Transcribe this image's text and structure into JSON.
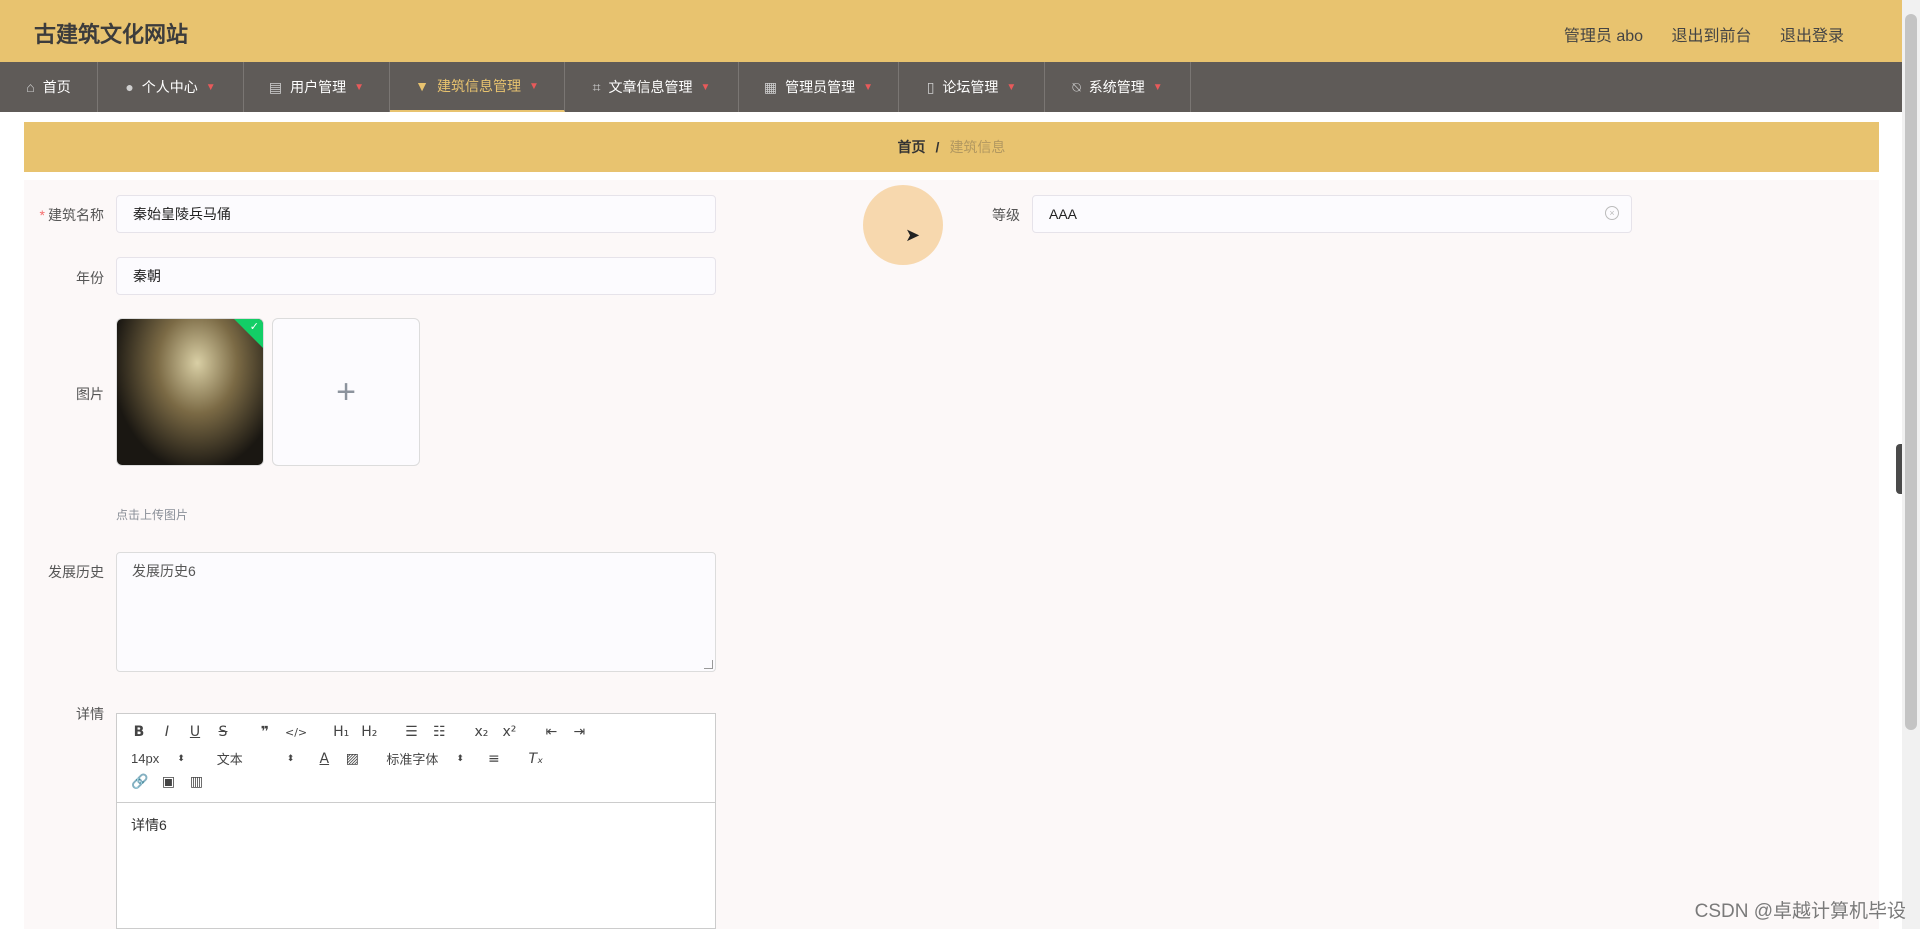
{
  "header": {
    "title": "古建筑文化网站",
    "admin_label": "管理员 abo",
    "goto_front": "退出到前台",
    "logout": "退出登录"
  },
  "nav": {
    "items": [
      {
        "label": "首页",
        "icon": "home-icon"
      },
      {
        "label": "个人中心",
        "icon": "user-icon"
      },
      {
        "label": "用户管理",
        "icon": "clipboard-icon"
      },
      {
        "label": "建筑信息管理",
        "icon": "brush-icon"
      },
      {
        "label": "文章信息管理",
        "icon": "crop-icon"
      },
      {
        "label": "管理员管理",
        "icon": "grid-icon"
      },
      {
        "label": "论坛管理",
        "icon": "mic-icon"
      },
      {
        "label": "系统管理",
        "icon": "bell-off-icon"
      }
    ],
    "active_index": 3,
    "accent_color": "#e8c36f"
  },
  "breadcrumb": {
    "home": "首页",
    "separator": "/",
    "current": "建筑信息"
  },
  "form": {
    "name_label": "建筑名称",
    "name_value": "秦始皇陵兵马俑",
    "level_label": "等级",
    "level_value": "AAA",
    "year_label": "年份",
    "year_value": "秦朝",
    "image_label": "图片",
    "upload_hint": "点击上传图片",
    "upload_plus": "+",
    "history_label": "发展历史",
    "history_value": "发展历史6",
    "detail_label": "详情",
    "detail_value": "详情6"
  },
  "editor": {
    "font_size": "14px",
    "block_type": "文本",
    "font_family": "标准字体",
    "buttons": [
      "B",
      "I",
      "U",
      "S",
      "❞",
      "</>",
      "H1",
      "H2",
      "ol",
      "ul",
      "x₂",
      "x²",
      "outdent",
      "indent"
    ]
  },
  "watermark": "CSDN @卓越计算机毕设"
}
